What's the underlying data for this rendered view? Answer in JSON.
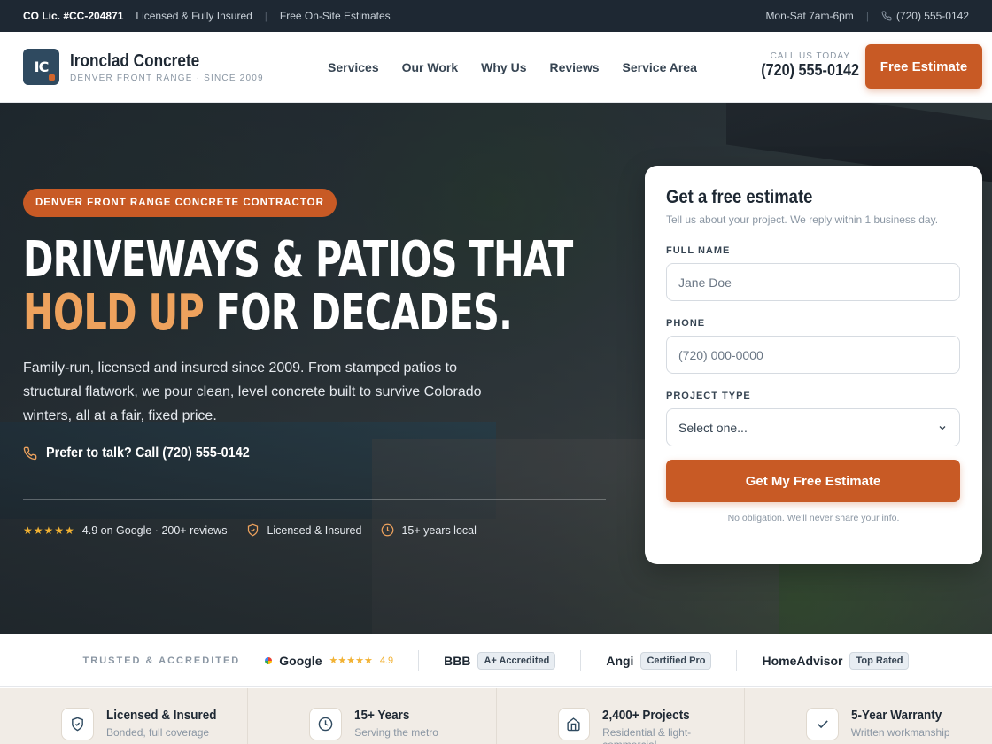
{
  "topbar": {
    "license": "CO Lic. #CC-204871",
    "licensed": "Licensed & Fully Insured",
    "estimates": "Free On-Site Estimates",
    "hours": "Mon-Sat 7am-6pm",
    "phone": "(720) 555-0142"
  },
  "header": {
    "logo_initials": "IC",
    "brand_name": "Ironclad Concrete",
    "brand_tagline": "DENVER FRONT RANGE · SINCE 2009",
    "nav": [
      "Services",
      "Our Work",
      "Why Us",
      "Reviews",
      "Service Area"
    ],
    "call_label": "CALL US TODAY",
    "call_number": "(720) 555-0142",
    "cta": "Free Estimate"
  },
  "hero": {
    "badge": "DENVER FRONT RANGE CONCRETE CONTRACTOR",
    "headline_line1": "DRIVEWAYS & PATIOS THAT",
    "headline_accent": "HOLD UP",
    "headline_rest": " FOR DECADES.",
    "lead": "Family-run, licensed and insured since 2009. From stamped patios to structural flatwork, we pour clean, level concrete built to survive Colorado winters, all at a fair, fixed price.",
    "talk": "Prefer to talk? Call (720) 555-0142",
    "stars": "★★★★★",
    "rating": "4.9 on Google · 200+ reviews",
    "insured": "Licensed & Insured",
    "years": "15+ years local"
  },
  "form": {
    "title": "Get a free estimate",
    "subtitle": "Tell us about your project. We reply within 1 business day.",
    "name_label": "FULL NAME",
    "name_placeholder": "Jane Doe",
    "phone_label": "PHONE",
    "phone_placeholder": "(720) 000-0000",
    "type_label": "PROJECT TYPE",
    "type_value": "Select one...",
    "submit": "Get My Free Estimate",
    "fine": "No obligation. We'll never share your info."
  },
  "trust": {
    "title": "TRUSTED & ACCREDITED",
    "google": "Google",
    "google_stars": "★★★★★",
    "google_rating": "4.9",
    "bbb": "BBB",
    "bbb_chip": "A+ Accredited",
    "angi": "Angi",
    "angi_chip": "Certified Pro",
    "homeadvisor": "HomeAdvisor",
    "homeadvisor_chip": "Top Rated"
  },
  "features": [
    {
      "title": "Licensed & Insured",
      "desc": "Bonded, full coverage",
      "icon": "shield-icon"
    },
    {
      "title": "15+ Years",
      "desc": "Serving the metro",
      "icon": "clock-icon"
    },
    {
      "title": "2,400+ Projects",
      "desc": "Residential & light-commercial",
      "icon": "home-icon"
    },
    {
      "title": "5-Year Warranty",
      "desc": "Written workmanship",
      "icon": "check-icon"
    }
  ],
  "colors": {
    "accent": "#c85a25",
    "dark": "#1e2833",
    "highlight": "#eea25d"
  }
}
